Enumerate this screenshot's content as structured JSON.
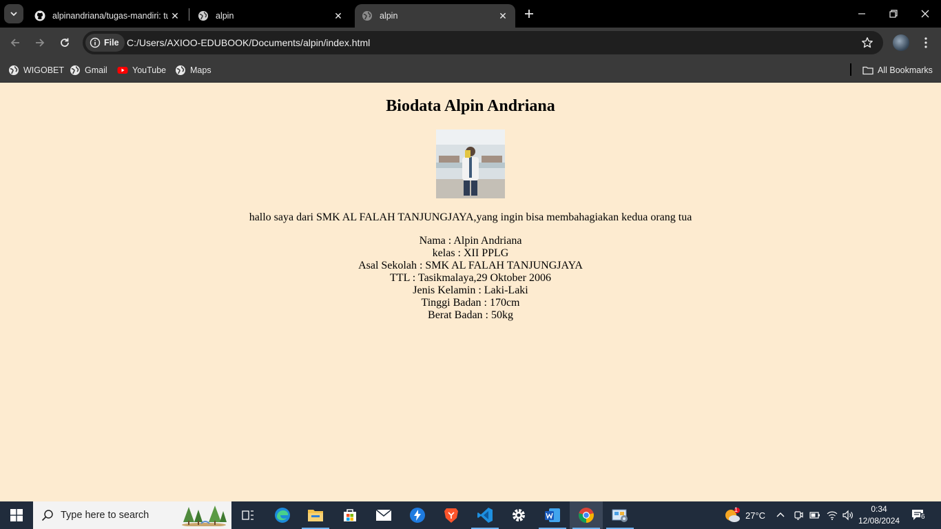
{
  "browser": {
    "tabs": [
      {
        "title": "alpinandriana/tugas-mandiri: tu",
        "icon": "github-icon",
        "active": false
      },
      {
        "title": "alpin",
        "icon": "globe-icon",
        "active": false
      },
      {
        "title": "alpin",
        "icon": "globe-icon",
        "active": true
      }
    ],
    "omnibox": {
      "chip_label": "File",
      "url": "C:/Users/AXIOO-EDUBOOK/Documents/alpin/index.html"
    },
    "bookmarks": [
      {
        "label": "WIGOBET",
        "icon": "globe-icon"
      },
      {
        "label": "Gmail",
        "icon": "globe-icon"
      },
      {
        "label": "YouTube",
        "icon": "youtube-icon"
      },
      {
        "label": "Maps",
        "icon": "globe-icon"
      }
    ],
    "all_bookmarks_label": "All Bookmarks",
    "page_background": "#fdebd0",
    "chrome_color": "#3a3a3a"
  },
  "page": {
    "heading": "Biodata Alpin Andriana",
    "intro": "hallo saya dari SMK AL FALAH TANJUNGJAYA,yang ingin bisa membahagiakan kedua orang tua",
    "bio": [
      "Nama : Alpin Andriana",
      "kelas : XII PPLG",
      "Asal Sekolah : SMK AL FALAH TANJUNGJAYA",
      "TTL : Tasikmalaya,29 Oktober 2006",
      "Jenis Kelamin : Laki-Laki",
      "Tinggi Badan : 170cm",
      "Berat Badan : 50kg"
    ]
  },
  "taskbar": {
    "search_placeholder": "Type here to search",
    "apps": [
      "task-view-icon",
      "edge-icon",
      "file-explorer-icon",
      "store-icon",
      "mail-icon",
      "bitwarden-icon",
      "brave-icon",
      "vscode-icon",
      "settings-icon",
      "word-icon",
      "chrome-icon",
      "control-panel-icon"
    ],
    "weather": {
      "temp": "27°C",
      "badge": "1"
    },
    "clock": {
      "time": "0:34",
      "date": "12/08/2024"
    },
    "notifications": "6"
  }
}
